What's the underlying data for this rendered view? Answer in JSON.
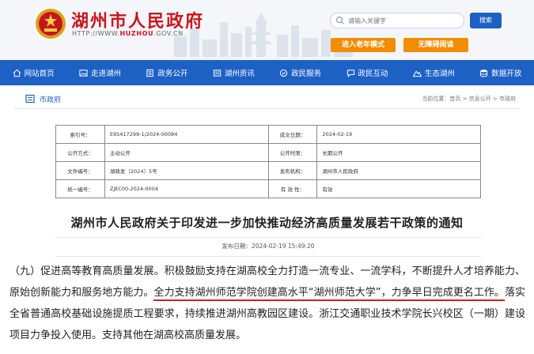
{
  "header": {
    "title": "湖州市人民政府",
    "url_prefix": "HTTP://WWW.",
    "url_domain": "HUZHOU",
    "url_suffix": ".GOV.CN",
    "search_placeholder": "请输入关键字",
    "search_button": "搜索",
    "elder_mode": "进入老年模式",
    "accessible_mode": "无障碍阅读",
    "brand_color": "#c8161d",
    "accent_color": "#1d61c5",
    "button_color": "#f28c00"
  },
  "nav": {
    "items": [
      {
        "label": "网站首页",
        "icon": "home-icon"
      },
      {
        "label": "走进湖州",
        "icon": "picture-icon"
      },
      {
        "label": "政务公开",
        "icon": "building-icon"
      },
      {
        "label": "湖州资讯",
        "icon": "news-icon"
      },
      {
        "label": "政民服务",
        "icon": "service-icon"
      },
      {
        "label": "政民互动",
        "icon": "interact-icon"
      },
      {
        "label": "生态湖州",
        "icon": "mountain-icon"
      },
      {
        "label": "数据开放",
        "icon": "data-icon"
      }
    ]
  },
  "breadcrumb": {
    "section": "市政府",
    "path": "当前位置：首页 > 信息公开 > 市政府"
  },
  "meta": {
    "rows": [
      [
        "索引号：",
        "E95417299-1/2024-00084",
        "成文日期：",
        "2024-02-19"
      ],
      [
        "公开方式：",
        "主动公开",
        "公开时限：",
        "长期公开"
      ],
      [
        "文件编号：",
        "湖政发〔2024〕5号",
        "发布机构：",
        "湖州市人民政府"
      ],
      [
        "统一编号：",
        "ZJEC00-2024-0004",
        "有 效 性：",
        "有效"
      ]
    ]
  },
  "document": {
    "title": "湖州市人民政府关于印发进一步加快推动经济高质量发展若干政策的通知",
    "publish_date": "发布日期：2024-02-19 15:49:20",
    "para_start": "（九）促进高等教育高质量发展。积极鼓励支持在湖高校全力打造一流专业、一流学科，不断提升人才培养能力、原始创新能力和服务地方能力。",
    "para_highlight": "全力支持湖州师范学院创建高水平“湖州师范大学”，力争早日完成更名工作。",
    "para_end": "落实全省普通高校基础设施提质工程要求，持续推进湖州高教园区建设。浙江交通职业技术学院长兴校区（一期）建设项目力争投入使用。支持其他在湖高校高质量发展。",
    "highlight_color": "#d61c1c"
  }
}
